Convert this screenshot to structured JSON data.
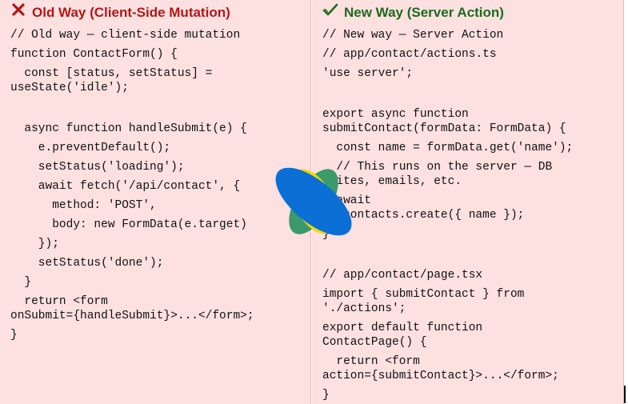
{
  "left": {
    "title": "Old Way (Client-Side Mutation)",
    "icon": "close-icon",
    "color": "#b01818",
    "lines": [
      "// Old way — client-side mutation",
      "function ContactForm() {",
      "  const [status, setStatus] =",
      "useState('idle');",
      "  async function handleSubmit(e) {",
      "    e.preventDefault();",
      "    setStatus('loading');",
      "    await fetch('/api/contact', {",
      "      method: 'POST',",
      "      body: new FormData(e.target)",
      "    });",
      "    setStatus('done');",
      "  }",
      "  return <form",
      "onSubmit={handleSubmit}>...</form>;",
      "}"
    ]
  },
  "right": {
    "title": "New Way (Server Action)",
    "icon": "check-icon",
    "color": "#1d6b1d",
    "lines": [
      "// New way — Server Action",
      "// app/contact/actions.ts",
      "'use server';",
      "export async function",
      "submitContact(formData: FormData) {",
      "  const name = formData.get('name');",
      "  // This runs on the server — DB",
      "writes, emails, etc.",
      "  await",
      "db.contacts.create({ name });",
      "}",
      "// app/contact/page.tsx",
      "import { submitContact } from",
      "'./actions';",
      "export default function",
      "ContactPage() {",
      "  return <form",
      "action={submitContact}>...</form>;",
      "}"
    ]
  },
  "logo": {
    "icon": "logo-icon",
    "colors": [
      "#f5d800",
      "#3a9a6a",
      "#0b6fd6"
    ]
  }
}
